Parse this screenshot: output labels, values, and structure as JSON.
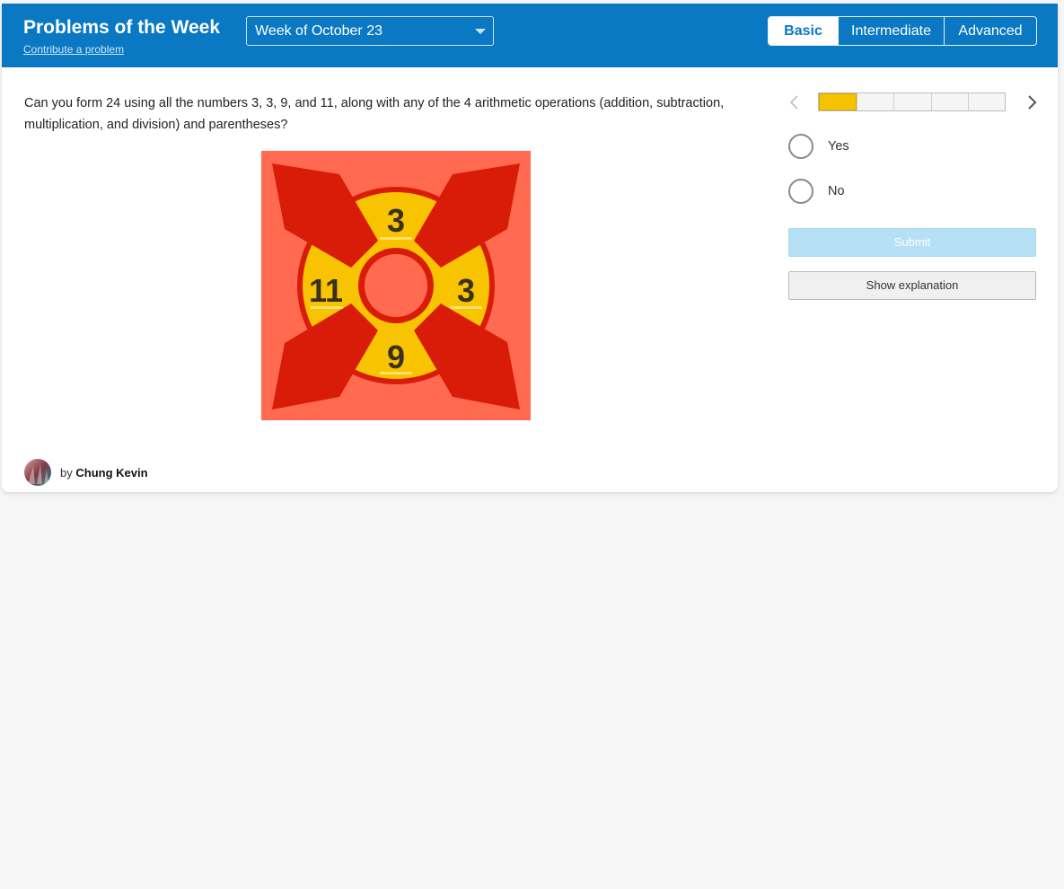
{
  "header": {
    "title": "Problems of the Week",
    "contribute_link": "Contribute a problem",
    "week_select": {
      "selected": "Week of October 23"
    },
    "levels": [
      {
        "label": "Basic",
        "active": true
      },
      {
        "label": "Intermediate",
        "active": false
      },
      {
        "label": "Advanced",
        "active": false
      }
    ]
  },
  "question": {
    "text": "Can you form 24 using all the numbers 3, 3, 9, and 11, along with any of the 4 arithmetic operations (addition, subtraction, multiplication, and division) and parentheses?"
  },
  "figure": {
    "numbers": {
      "top": "3",
      "left": "11",
      "right": "3",
      "bottom": "9"
    },
    "colors": {
      "background": "#ff6a50",
      "wheel": "#f8c300",
      "arms": "#d91c08"
    }
  },
  "author": {
    "prefix": "by",
    "name": "Chung Kevin"
  },
  "progress": {
    "current": 1,
    "total": 5
  },
  "answers": [
    {
      "label": "Yes"
    },
    {
      "label": "No"
    }
  ],
  "buttons": {
    "submit": "Submit",
    "explanation": "Show explanation"
  },
  "colors": {
    "header": "#0a78c2",
    "progress_fill": "#f6c300",
    "submit_disabled": "#b6e0f5"
  }
}
